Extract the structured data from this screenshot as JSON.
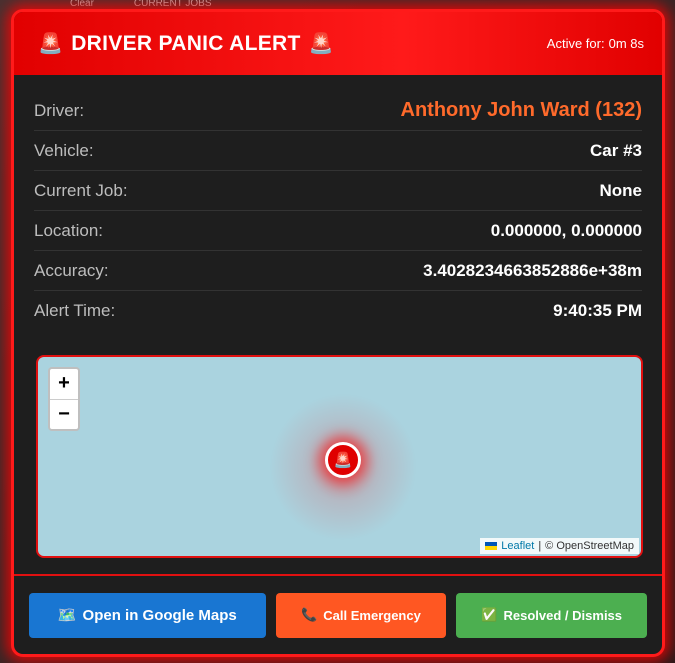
{
  "background": {
    "strip_items": [
      "Clear",
      "CURRENT JOBS"
    ]
  },
  "header": {
    "title": "DRIVER PANIC ALERT",
    "siren_glyph": "🚨",
    "active_label": "Active for:",
    "active_value": "0m 8s"
  },
  "details": {
    "rows": [
      {
        "label": "Driver:",
        "value": "Anthony John Ward (132)"
      },
      {
        "label": "Vehicle:",
        "value": "Car #3"
      },
      {
        "label": "Current Job:",
        "value": "None"
      },
      {
        "label": "Location:",
        "value": "0.000000, 0.000000"
      },
      {
        "label": "Accuracy:",
        "value": "3.4028234663852886e+38m"
      },
      {
        "label": "Alert Time:",
        "value": "9:40:35 PM"
      }
    ]
  },
  "map": {
    "zoom_in": "+",
    "zoom_out": "−",
    "marker_glyph": "🚨",
    "attribution_link": "Leaflet",
    "attribution_sep": "|",
    "attribution_text": "© OpenStreetMap"
  },
  "actions": {
    "maps_icon": "🗺️",
    "maps_label": "Open in Google Maps",
    "call_icon": "📞",
    "call_label": "Call Emergency",
    "resolve_icon": "✅",
    "resolve_label": "Resolved / Dismiss"
  },
  "colors": {
    "alert_red": "#ff1a1a",
    "driver_orange": "#ff6a2b",
    "maps_blue": "#1976d2",
    "call_orange": "#ff5722",
    "resolve_green": "#4caf50",
    "water": "#aad3df"
  }
}
